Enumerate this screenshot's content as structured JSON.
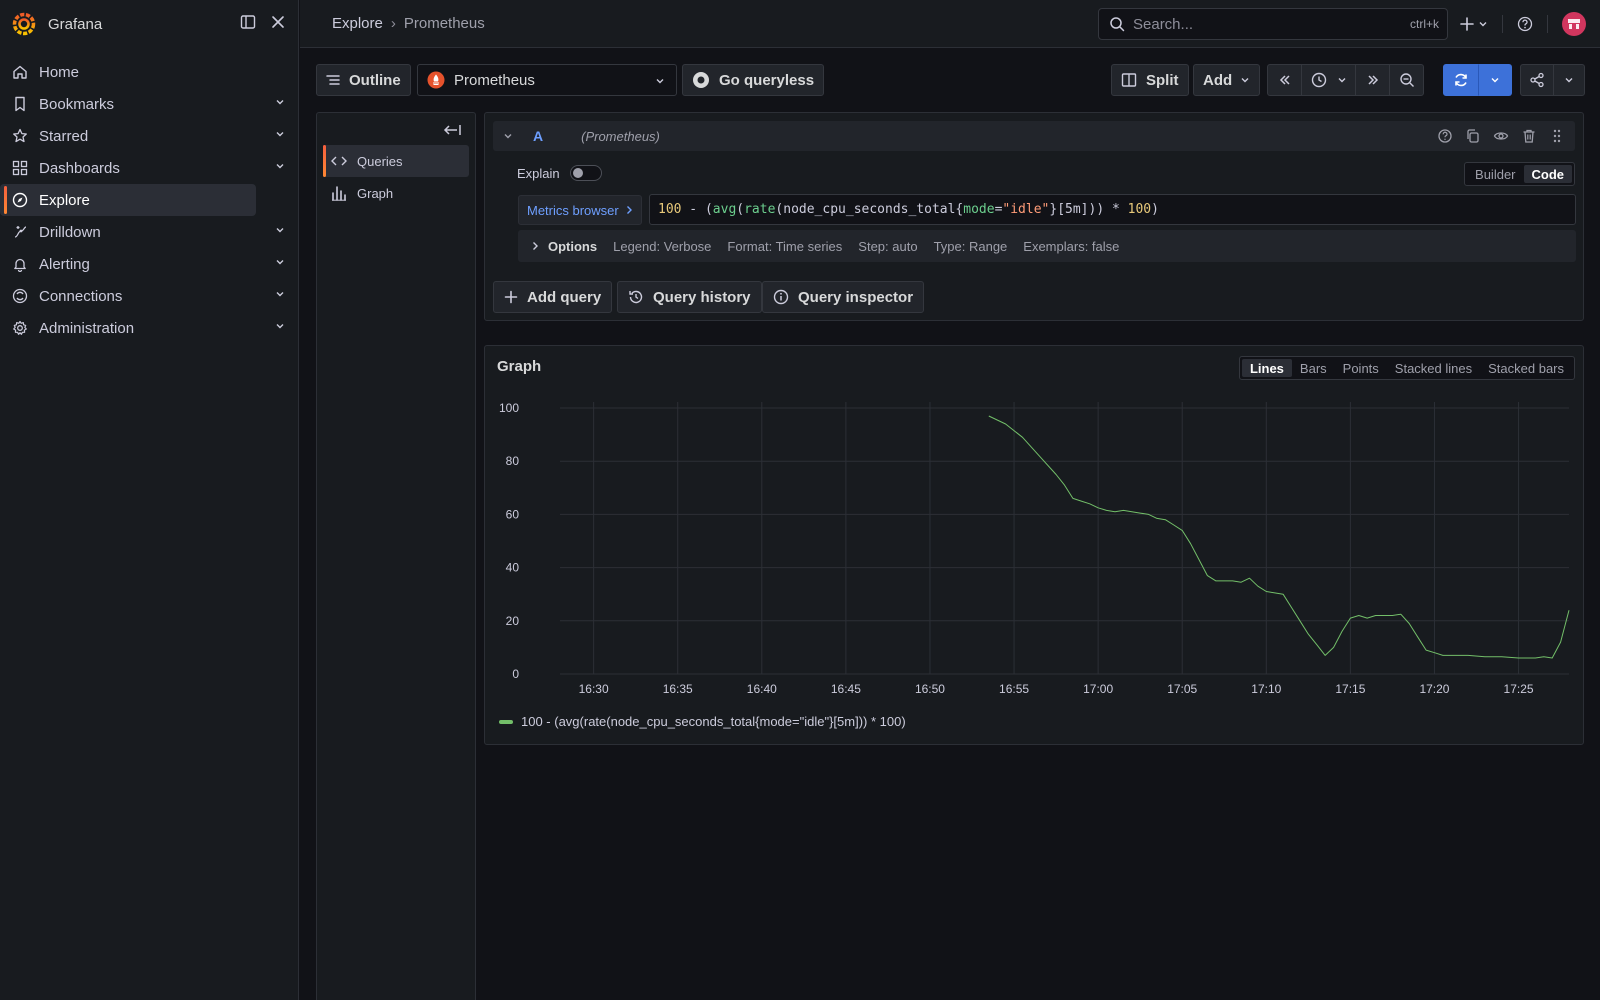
{
  "app": {
    "name": "Grafana"
  },
  "sidebar": {
    "items": [
      {
        "label": "Home",
        "icon": "home-icon",
        "expandable": false,
        "active": false
      },
      {
        "label": "Bookmarks",
        "icon": "bookmark-icon",
        "expandable": true,
        "active": false
      },
      {
        "label": "Starred",
        "icon": "star-icon",
        "expandable": true,
        "active": false
      },
      {
        "label": "Dashboards",
        "icon": "dashboards-icon",
        "expandable": true,
        "active": false
      },
      {
        "label": "Explore",
        "icon": "compass-icon",
        "expandable": false,
        "active": true
      },
      {
        "label": "Drilldown",
        "icon": "drilldown-icon",
        "expandable": true,
        "active": false
      },
      {
        "label": "Alerting",
        "icon": "bell-icon",
        "expandable": true,
        "active": false
      },
      {
        "label": "Connections",
        "icon": "connections-icon",
        "expandable": true,
        "active": false
      },
      {
        "label": "Administration",
        "icon": "gear-icon",
        "expandable": true,
        "active": false
      }
    ]
  },
  "topbar": {
    "breadcrumb": [
      "Explore",
      "Prometheus"
    ],
    "search_placeholder": "Search...",
    "search_shortcut": "ctrl+k"
  },
  "toolbar": {
    "outline_label": "Outline",
    "datasource": "Prometheus",
    "queryless_label": "Go queryless",
    "split_label": "Split",
    "add_label": "Add"
  },
  "outline": {
    "items": [
      {
        "label": "Queries",
        "icon": "code-icon",
        "active": true
      },
      {
        "label": "Graph",
        "icon": "bar-chart-icon",
        "active": false
      }
    ]
  },
  "query": {
    "ref_id": "A",
    "datasource_label": "(Prometheus)",
    "explain_label": "Explain",
    "mode_builder": "Builder",
    "mode_code": "Code",
    "mode_selected": "Code",
    "metrics_browser_label": "Metrics browser",
    "expression": "100 - (avg(rate(node_cpu_seconds_total{mode=\"idle\"}[5m])) * 100)",
    "options_label": "Options",
    "options_meta": [
      "Legend: Verbose",
      "Format: Time series",
      "Step: auto",
      "Type: Range",
      "Exemplars: false"
    ],
    "add_query_label": "Add query",
    "history_label": "Query history",
    "inspector_label": "Query inspector"
  },
  "graph": {
    "title": "Graph",
    "vis_options": [
      "Lines",
      "Bars",
      "Points",
      "Stacked lines",
      "Stacked bars"
    ],
    "vis_selected": "Lines"
  },
  "colors": {
    "accent_orange": "#ff8833",
    "primary_blue": "#3d71d9",
    "series_green": "#73bf69",
    "link_blue": "#6e9fff"
  },
  "chart_data": {
    "type": "line",
    "title": "",
    "xlabel": "",
    "ylabel": "",
    "ylim": [
      0,
      100
    ],
    "yticks": [
      0,
      20,
      40,
      60,
      80,
      100
    ],
    "xlim": [
      "16:28",
      "17:28"
    ],
    "xticks": [
      "16:30",
      "16:35",
      "16:40",
      "16:45",
      "16:50",
      "16:55",
      "17:00",
      "17:05",
      "17:10",
      "17:15",
      "17:20",
      "17:25"
    ],
    "grid": true,
    "legend": "bottom-left",
    "series": [
      {
        "name": "100 - (avg(rate(node_cpu_seconds_total{mode=\"idle\"}[5m])) * 100)",
        "color": "#73bf69",
        "x": [
          "16:53.5",
          "16:54.5",
          "16:55.5",
          "16:56.5",
          "16:57.5",
          "16:58",
          "16:58.5",
          "16:59",
          "16:59.5",
          "17:00",
          "17:00.5",
          "17:01",
          "17:01.5",
          "17:02",
          "17:02.5",
          "17:03",
          "17:03.5",
          "17:04",
          "17:04.5",
          "17:05",
          "17:05.5",
          "17:06",
          "17:06.5",
          "17:07",
          "17:07.5",
          "17:08",
          "17:08.5",
          "17:09",
          "17:09.5",
          "17:10",
          "17:10.5",
          "17:11",
          "17:11.5",
          "17:12",
          "17:12.5",
          "17:13",
          "17:13.5",
          "17:14",
          "17:14.5",
          "17:15",
          "17:15.5",
          "17:16",
          "17:16.5",
          "17:17",
          "17:17.5",
          "17:18",
          "17:18.5",
          "17:19",
          "17:19.5",
          "17:20",
          "17:20.5",
          "17:21",
          "17:22",
          "17:23",
          "17:24",
          "17:25",
          "17:26",
          "17:26.5",
          "17:27",
          "17:27.5",
          "17:28"
        ],
        "values": [
          97,
          94,
          89,
          82,
          75,
          71,
          66,
          65,
          64,
          62.5,
          61.5,
          61,
          61.5,
          61,
          60.5,
          60,
          58.5,
          58,
          56,
          54,
          49,
          43,
          37,
          35,
          35,
          35,
          34.5,
          36,
          33,
          31,
          30.5,
          30,
          25,
          20,
          15,
          11,
          7,
          10,
          16,
          21,
          22,
          21,
          22,
          22,
          22,
          22.5,
          19,
          14,
          9,
          8,
          7,
          7,
          7,
          6.5,
          6.5,
          6,
          6,
          6.5,
          6,
          12,
          24
        ]
      }
    ]
  }
}
